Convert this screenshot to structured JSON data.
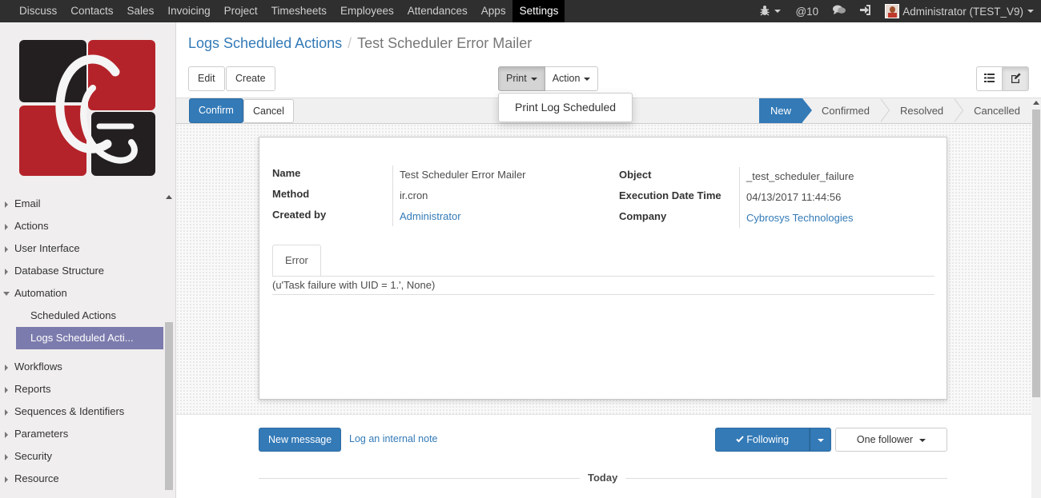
{
  "topbar": {
    "menu": [
      "Discuss",
      "Contacts",
      "Sales",
      "Invoicing",
      "Project",
      "Timesheets",
      "Employees",
      "Attendances",
      "Apps",
      "Settings"
    ],
    "active_menu": "Settings",
    "messages_count": "@10",
    "user": "Administrator (TEST_V9)"
  },
  "sidebar": {
    "items": [
      {
        "label": "Email",
        "expanded": false
      },
      {
        "label": "Actions",
        "expanded": false
      },
      {
        "label": "User Interface",
        "expanded": false
      },
      {
        "label": "Database Structure",
        "expanded": false
      },
      {
        "label": "Automation",
        "expanded": true
      }
    ],
    "subitems": [
      "Scheduled Actions",
      "Logs Scheduled Acti..."
    ],
    "items_after": [
      "Workflows",
      "Reports",
      "Sequences & Identifiers",
      "Parameters",
      "Security",
      "Resource"
    ]
  },
  "breadcrumb": {
    "parent": "Logs Scheduled Actions",
    "current": "Test Scheduler Error Mailer"
  },
  "buttons": {
    "edit": "Edit",
    "create": "Create",
    "print": "Print",
    "action": "Action",
    "confirm": "Confirm",
    "cancel": "Cancel"
  },
  "print_menu": {
    "options": [
      "Print Log Scheduled"
    ]
  },
  "stages": [
    "New",
    "Confirmed",
    "Resolved",
    "Cancelled"
  ],
  "active_stage": "New",
  "form": {
    "name_label": "Name",
    "name": "Test Scheduler Error Mailer",
    "method_label": "Method",
    "method": "ir.cron",
    "created_by_label": "Created by",
    "created_by": "Administrator",
    "object_label": "Object",
    "object": "_test_scheduler_failure",
    "exec_label": "Execution Date Time",
    "exec": "04/13/2017 11:44:56",
    "company_label": "Company",
    "company": "Cybrosys Technologies",
    "tab": "Error",
    "error_text": "(u'Task failure with UID = 1.', None)"
  },
  "chatter": {
    "new_message": "New message",
    "log_note": "Log an internal note",
    "following": "Following",
    "followers": "One follower",
    "today": "Today"
  },
  "colors": {
    "primary": "#337ab7",
    "topbar": "#2f2f2f",
    "menu_active": "#7c7bad",
    "logo_red": "#b5232a",
    "logo_dark": "#231f20"
  }
}
